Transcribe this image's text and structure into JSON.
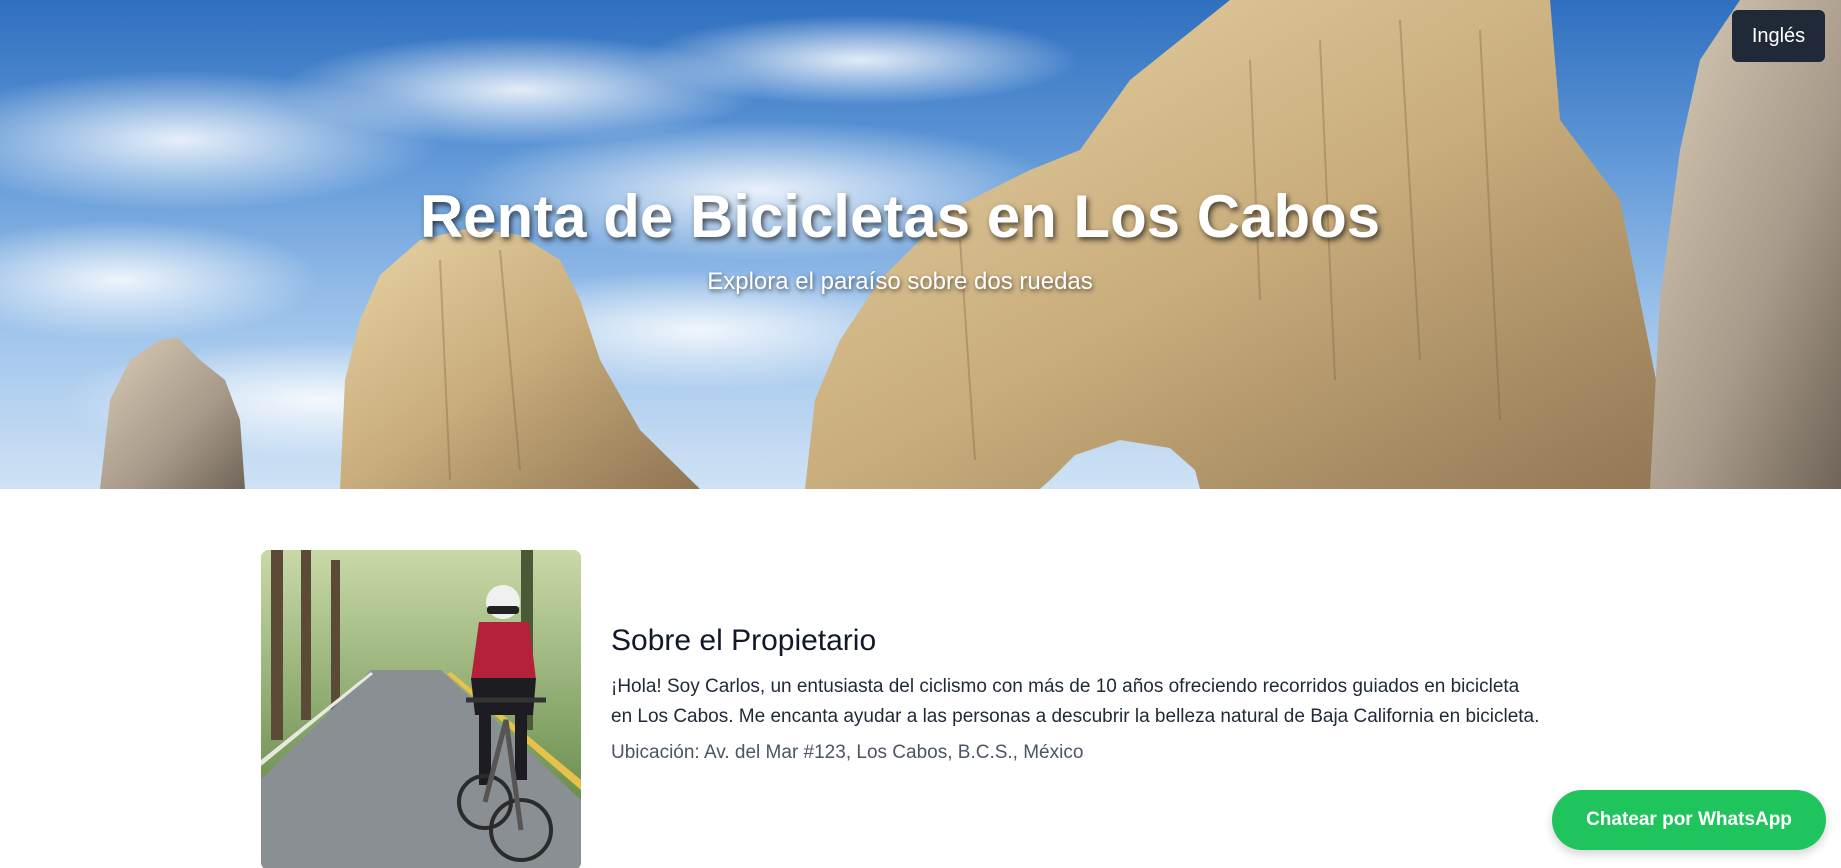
{
  "hero": {
    "title": "Renta de Bicicletas en Los Cabos",
    "subtitle": "Explora el paraíso sobre dos ruedas",
    "language_button": "Inglés"
  },
  "about": {
    "heading": "Sobre el Propietario",
    "body": "¡Hola! Soy Carlos, un entusiasta del ciclismo con más de 10 años ofreciendo recorridos guiados en bicicleta en Los Cabos. Me encanta ayudar a las personas a descubrir la belleza natural de Baja California en bicicleta.",
    "location": "Ubicación: Av. del Mar #123, Los Cabos, B.C.S., México"
  },
  "whatsapp": {
    "label": "Chatear por WhatsApp",
    "color": "#1fc45d"
  },
  "colors": {
    "language_button_bg": "#1f2937",
    "location_text": "#4b5563"
  }
}
